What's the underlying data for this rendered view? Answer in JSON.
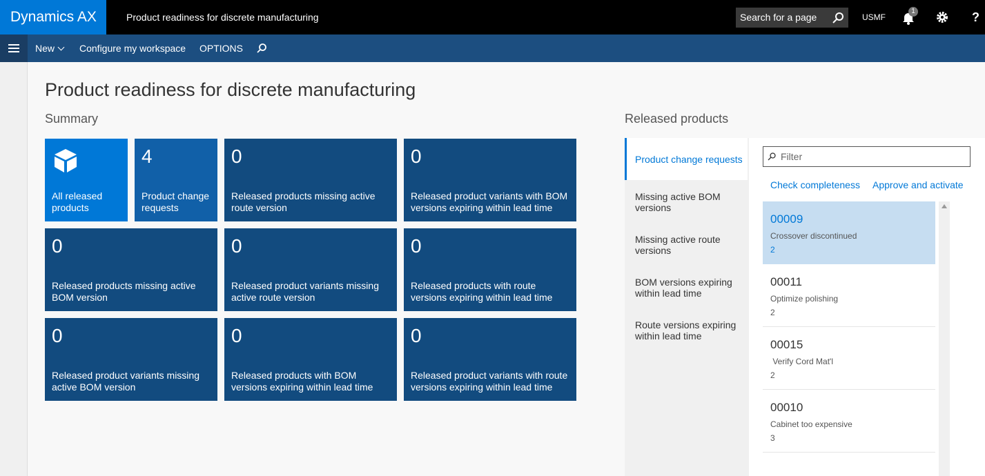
{
  "app": {
    "brand": "Dynamics AX",
    "page_name": "Product readiness for discrete manufacturing",
    "search_placeholder": "Search for a page",
    "company": "USMF",
    "notification_count": "1",
    "help": "?"
  },
  "commandbar": {
    "new_label": "New",
    "configure_label": "Configure my workspace",
    "options_label": "OPTIONS"
  },
  "main": {
    "title": "Product readiness for discrete manufacturing",
    "summary_title": "Summary",
    "tiles": [
      {
        "count": "",
        "label": "All released products",
        "icon": "box-icon"
      },
      {
        "count": "4",
        "label": "Product change requests"
      },
      {
        "count": "0",
        "label": "Released products missing active route version"
      },
      {
        "count": "0",
        "label": "Released product variants with BOM versions expiring within lead time"
      },
      {
        "count": "0",
        "label": "Released products missing active BOM version"
      },
      {
        "count": "0",
        "label": "Released product variants missing active route version"
      },
      {
        "count": "0",
        "label": "Released products with route versions expiring within lead time"
      },
      {
        "count": "0",
        "label": "Released product variants missing active BOM version"
      },
      {
        "count": "0",
        "label": "Released products with BOM versions expiring within lead time"
      },
      {
        "count": "0",
        "label": "Released product variants with route versions expiring within lead time"
      }
    ]
  },
  "released": {
    "title": "Released products",
    "nav": [
      {
        "label": "Product change requests",
        "active": true
      },
      {
        "label": "Missing active BOM versions"
      },
      {
        "label": "Missing active route versions"
      },
      {
        "label": "BOM versions expiring within lead time"
      },
      {
        "label": "Route versions expiring within lead time"
      }
    ],
    "filter_placeholder": "Filter",
    "actions": {
      "check": "Check completeness",
      "approve": "Approve and activate"
    },
    "items": [
      {
        "id": "00009",
        "desc": "Crossover discontinued",
        "num": "2"
      },
      {
        "id": "00011",
        "desc": "Optimize polishing",
        "num": "2"
      },
      {
        "id": "00015",
        "desc": " Verify Cord Mat'l",
        "num": "2"
      },
      {
        "id": "00010",
        "desc": "Cabinet too expensive",
        "num": "3"
      }
    ]
  },
  "colors": {
    "brand": "#0078d7",
    "topbar": "#000000",
    "commandbar": "#1c4e80",
    "tile_dark": "#124b7f",
    "tile_light": "#0078d7",
    "selected_row": "#c6ddf1"
  }
}
